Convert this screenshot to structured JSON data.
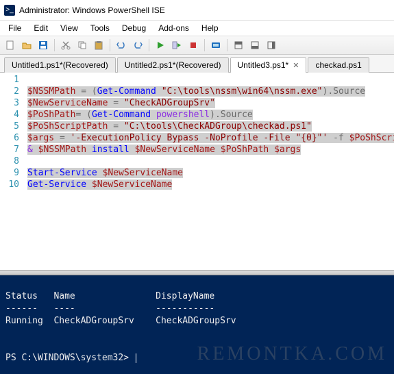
{
  "window": {
    "title": "Administrator: Windows PowerShell ISE",
    "icon_glyph": ">_"
  },
  "menu": {
    "items": [
      "File",
      "Edit",
      "View",
      "Tools",
      "Debug",
      "Add-ons",
      "Help"
    ]
  },
  "toolbar": {
    "buttons": [
      {
        "name": "new",
        "color": "#f5f5f5"
      },
      {
        "name": "open",
        "color": "#f0c36d"
      },
      {
        "name": "save",
        "color": "#1e6fbf"
      },
      {
        "name": "sep"
      },
      {
        "name": "cut",
        "color": "#888"
      },
      {
        "name": "copy",
        "color": "#888"
      },
      {
        "name": "paste",
        "color": "#888"
      },
      {
        "name": "sep"
      },
      {
        "name": "undo",
        "color": "#3a7ac0"
      },
      {
        "name": "redo",
        "color": "#3a7ac0"
      },
      {
        "name": "sep"
      },
      {
        "name": "run",
        "color": "#2e9e2e"
      },
      {
        "name": "run-selection",
        "color": "#2e9e2e"
      },
      {
        "name": "stop",
        "color": "#c33"
      },
      {
        "name": "sep"
      },
      {
        "name": "new-remote",
        "color": "#1e6fbf"
      },
      {
        "name": "sep"
      },
      {
        "name": "show-script",
        "color": "#666"
      },
      {
        "name": "show-console",
        "color": "#666"
      },
      {
        "name": "show-both",
        "color": "#666"
      }
    ]
  },
  "tabs": {
    "items": [
      {
        "label": "Untitled1.ps1*(Recovered)",
        "active": false,
        "close": false
      },
      {
        "label": "Untitled2.ps1*(Recovered)",
        "active": false,
        "close": false
      },
      {
        "label": "Untitled3.ps1*",
        "active": true,
        "close": true
      },
      {
        "label": "checkad.ps1",
        "active": false,
        "close": false
      }
    ]
  },
  "code": {
    "lines": [
      "1",
      "2",
      "3",
      "4",
      "5",
      "6",
      "7",
      "8",
      "9",
      "10"
    ],
    "t1_var": "$NSSMPath",
    "t1_eq": " = (",
    "t1_cmd": "Get-Command",
    "t1_sp": " ",
    "t1_str": "\"C:\\tools\\nssm\\win64\\nssm.exe\"",
    "t1_end": ").Source",
    "t2_var": "$NewServiceName",
    "t2_eq": " = ",
    "t2_str": "\"CheckADGroupSrv\"",
    "t3_var": "$PoShPath",
    "t3_eq": "= (",
    "t3_cmd": "Get-Command",
    "t3_sp": " ",
    "t3_arg": "powershell",
    "t3_end": ").Source",
    "t4_var": "$PoShScriptPath",
    "t4_eq": " = ",
    "t4_str": "\"C:\\tools\\CheckADGroup\\checkad.ps1\"",
    "t5_var": "$args",
    "t5_eq": " = ",
    "t5_str": "'-ExecutionPolicy Bypass -NoProfile -File \"{0}\"'",
    "t5_f": " -f ",
    "t5_v2": "$PoShScriptP",
    "t6_amp": "&",
    "t6_sp": " ",
    "t6_v1": "$NSSMPath",
    "t6_cmd": " install ",
    "t6_v2": "$NewServiceName",
    "t6_sp2": " ",
    "t6_v3": "$PoShPath",
    "t6_sp3": " ",
    "t6_v4": "$args",
    "t8_cmd": "Start-Service",
    "t8_sp": " ",
    "t8_v": "$NewServiceName",
    "t9_cmd": "Get-Service",
    "t9_sp": " ",
    "t9_v": "$NewServiceName"
  },
  "console": {
    "header1": "Status   Name               DisplayName",
    "header2": "------   ----               -----------",
    "row1": "Running  CheckADGroupSrv    CheckADGroupSrv",
    "blank1": "",
    "blank2": "",
    "prompt": "PS C:\\WINDOWS\\system32> "
  },
  "watermark": "REMONTKA.COM"
}
